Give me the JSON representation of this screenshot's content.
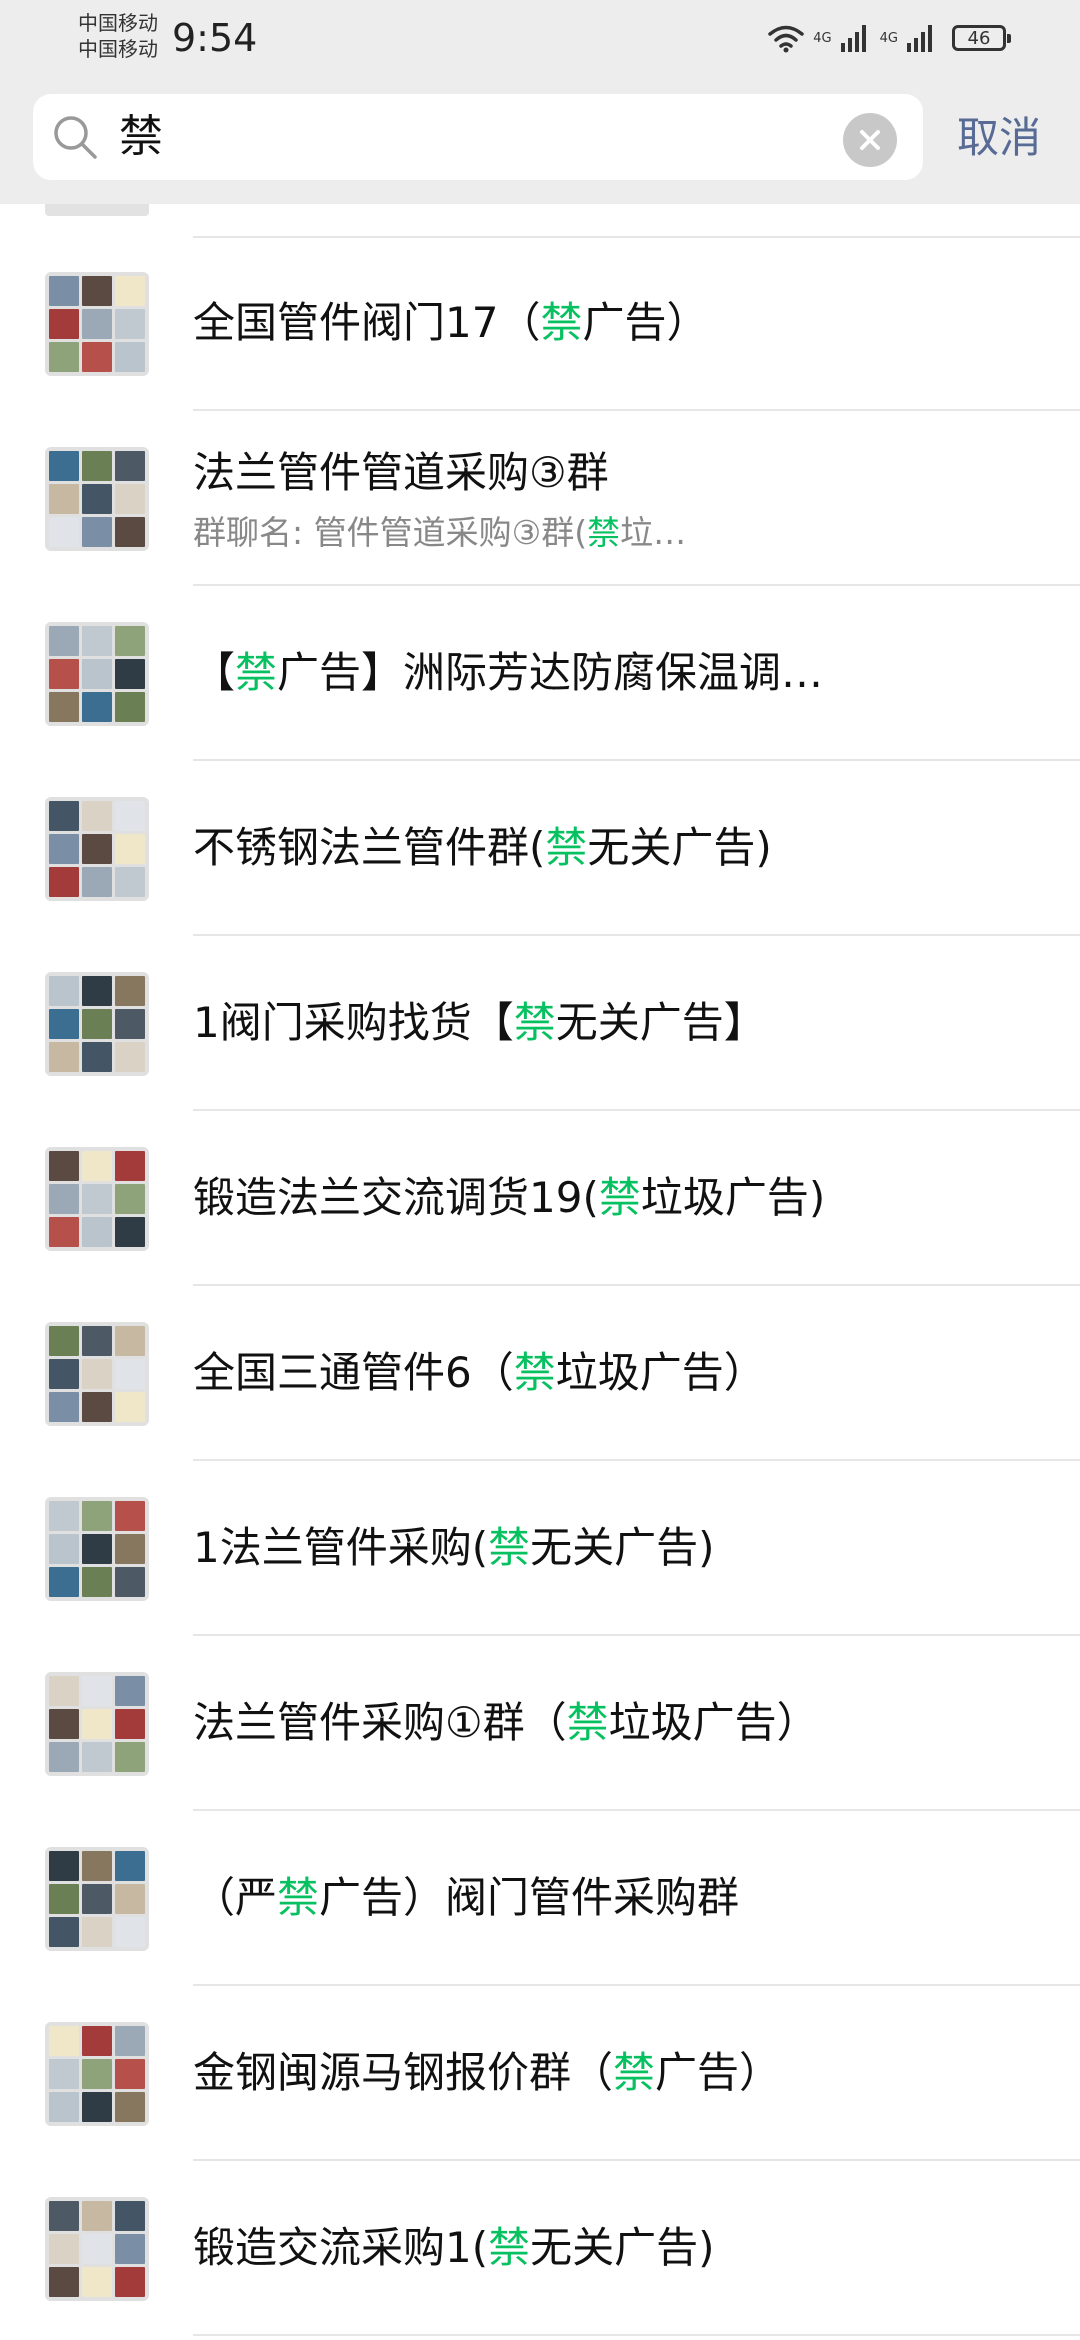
{
  "status_bar": {
    "carrier1": "中国移动",
    "carrier2": "中国移动",
    "time": "9:54",
    "net1": "4G",
    "net2": "4G",
    "battery": "46"
  },
  "search": {
    "query": "禁",
    "cancel_label": "取消"
  },
  "colors": {
    "highlight": "#07c160",
    "cancel": "#576b95",
    "header_bg": "#ededed"
  },
  "results": [
    {
      "pre": "全国管件阀门17（",
      "hl": "禁",
      "post": "广告）"
    },
    {
      "pre": "法兰管件管道采购③群",
      "hl": "",
      "post": "",
      "sub_pre": "群聊名: 管件管道采购③群(",
      "sub_hl": "禁",
      "sub_post": "垃…"
    },
    {
      "pre": "【",
      "hl": "禁",
      "post": "广告】洲际芳达防腐保温调…"
    },
    {
      "pre": "不锈钢法兰管件群(",
      "hl": "禁",
      "post": "无关广告)"
    },
    {
      "pre": "1阀门采购找货【",
      "hl": "禁",
      "post": "无关广告】"
    },
    {
      "pre": "锻造法兰交流调货19(",
      "hl": "禁",
      "post": "垃圾广告)"
    },
    {
      "pre": "全国三通管件6（",
      "hl": "禁",
      "post": "垃圾广告）"
    },
    {
      "pre": "1法兰管件采购(",
      "hl": "禁",
      "post": "无关广告)"
    },
    {
      "pre": "法兰管件采购①群（",
      "hl": "禁",
      "post": "垃圾广告）"
    },
    {
      "pre": "（严",
      "hl": "禁",
      "post": "广告）阀门管件采购群"
    },
    {
      "pre": "金钢闽源马钢报价群（",
      "hl": "禁",
      "post": "广告）"
    },
    {
      "pre": "锻造交流采购1(",
      "hl": "禁",
      "post": "无关广告)"
    }
  ]
}
